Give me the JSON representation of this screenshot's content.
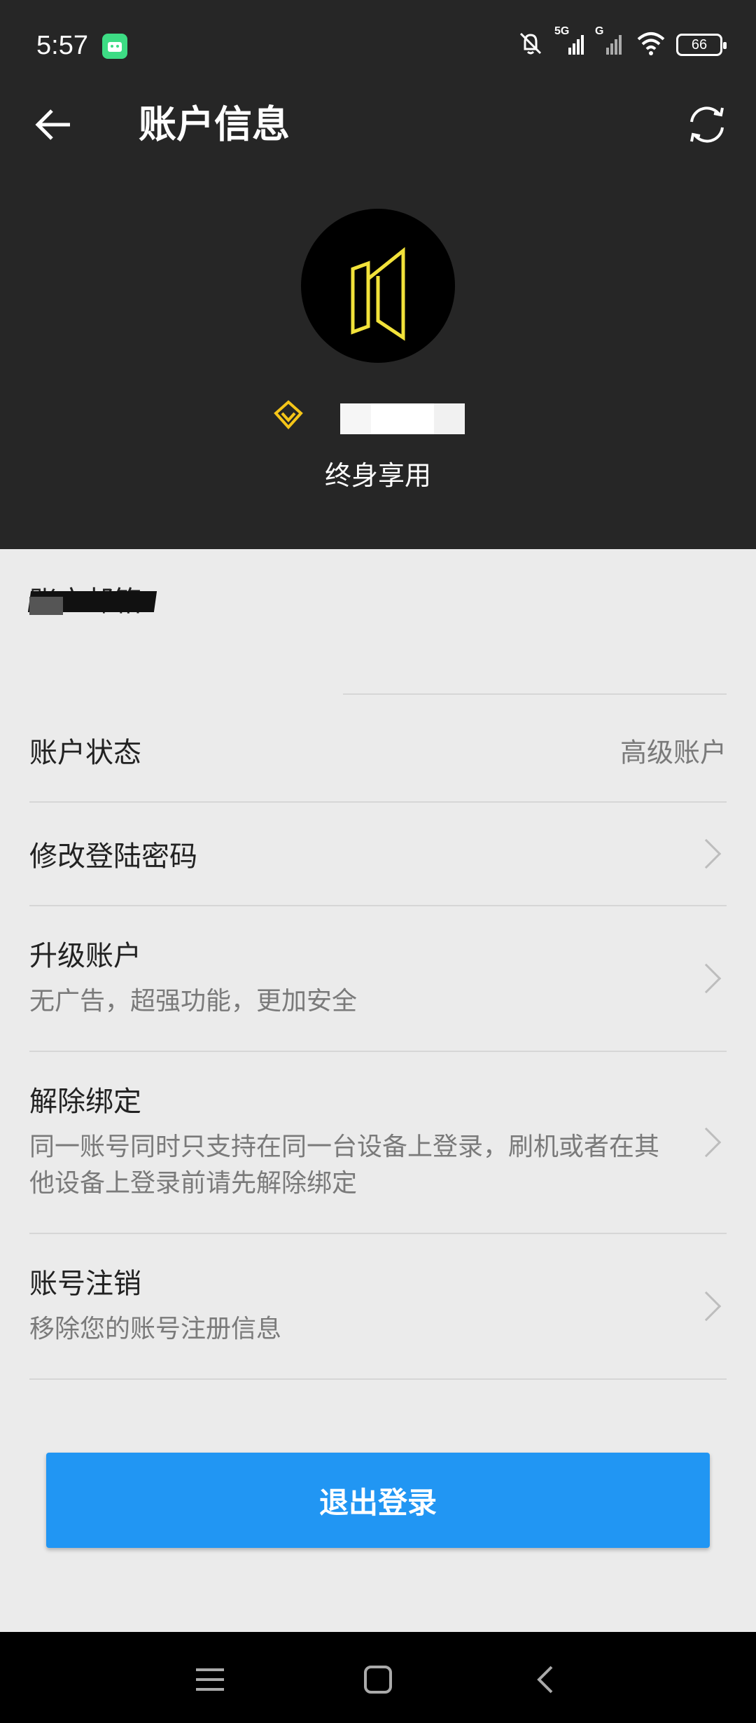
{
  "status_bar": {
    "time": "5:57",
    "battery": "66",
    "network_5g": "5G",
    "network_g": "G",
    "icons": [
      "android-notification-icon",
      "bell-off-icon",
      "signal-5g-icon",
      "signal-g-icon",
      "wifi-icon",
      "battery-icon"
    ]
  },
  "header": {
    "title": "账户信息",
    "membership": "终身享用",
    "icons": [
      "back-arrow-icon",
      "refresh-icon",
      "app-logo-icon",
      "vip-diamond-icon"
    ],
    "colors": {
      "background": "#262626",
      "logo": "#f2e23a",
      "vip": "#f5c518"
    }
  },
  "account": {
    "email_label": "账户邮箱",
    "rows": [
      {
        "title": "账户状态",
        "value": "高级账户"
      },
      {
        "title": "修改登陆密码"
      },
      {
        "title": "升级账户",
        "subtitle": "无广告，超强功能，更加安全"
      },
      {
        "title": "解除绑定",
        "subtitle": "同一账号同时只支持在同一台设备上登录，刷机或者在其他设备上登录前请先解除绑定"
      },
      {
        "title": "账号注销",
        "subtitle": "移除您的账号注册信息"
      }
    ]
  },
  "logout": {
    "label": "退出登录",
    "color": "#2196f3"
  },
  "nav": {
    "icons": [
      "menu-icon",
      "home-icon",
      "back-icon"
    ]
  }
}
